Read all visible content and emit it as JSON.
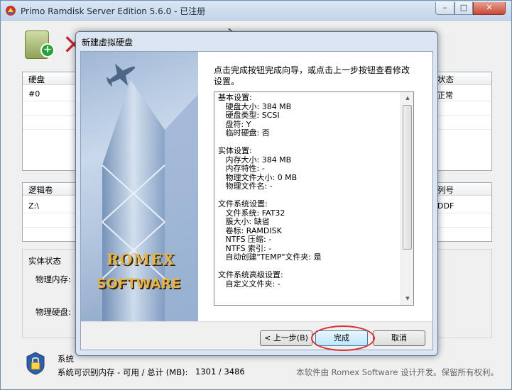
{
  "main": {
    "title": "Primo Ramdisk Server Edition 5.6.0 - 已注册",
    "caption_min": "–",
    "caption_max": "□",
    "caption_close": "✕",
    "disks_panel": {
      "col_disk": "硬盘",
      "col_status": "状态",
      "row_disk": "#0",
      "row_status": "正常"
    },
    "volumes_panel": {
      "col_volume": "逻辑卷",
      "col_serial": "列号",
      "row_volume": "Z:\\",
      "row_serial": "DDF"
    },
    "status_panel": {
      "title": "实体状态",
      "physical_memory": "物理内存:",
      "physical_disk": "物理硬盘:"
    },
    "status_line_1": "系统",
    "status_line_2": "系统可识别内存 - 可用 / 总计 (MB):",
    "memory_values": "1301 / 3486",
    "copyright": "本软件由 Romex Software 设计开发。保留所有权利。"
  },
  "dialog": {
    "title": "新建虚拟硬盘",
    "intro": "点击完成按钮完成向导，或点击上一步按钮查看修改设置。",
    "logo_line_1": "ROMEX",
    "logo_line_2": "SOFTWARE",
    "summary": [
      "基本设置:",
      "   硬盘大小: 384 MB",
      "   硬盘类型: SCSI",
      "   盘符: Y",
      "   临时硬盘: 否",
      "",
      "实体设置:",
      "   内存大小: 384 MB",
      "   内存特性: -",
      "   物理文件大小: 0 MB",
      "   物理文件名: -",
      "",
      "文件系统设置:",
      "   文件系统: FAT32",
      "   簇大小: 缺省",
      "   卷标: RAMDISK",
      "   NTFS 压缩: -",
      "   NTFS 索引: -",
      "   自动创建\"TEMP\"文件夹: 是",
      "",
      "文件系统高级设置:",
      "   自定义文件夹: -"
    ],
    "buttons": {
      "back": "< 上一步(B)",
      "finish": "完成",
      "cancel": "取消"
    }
  },
  "colors": {
    "highlight": "#d93030",
    "accent": "#3c7fb1"
  }
}
